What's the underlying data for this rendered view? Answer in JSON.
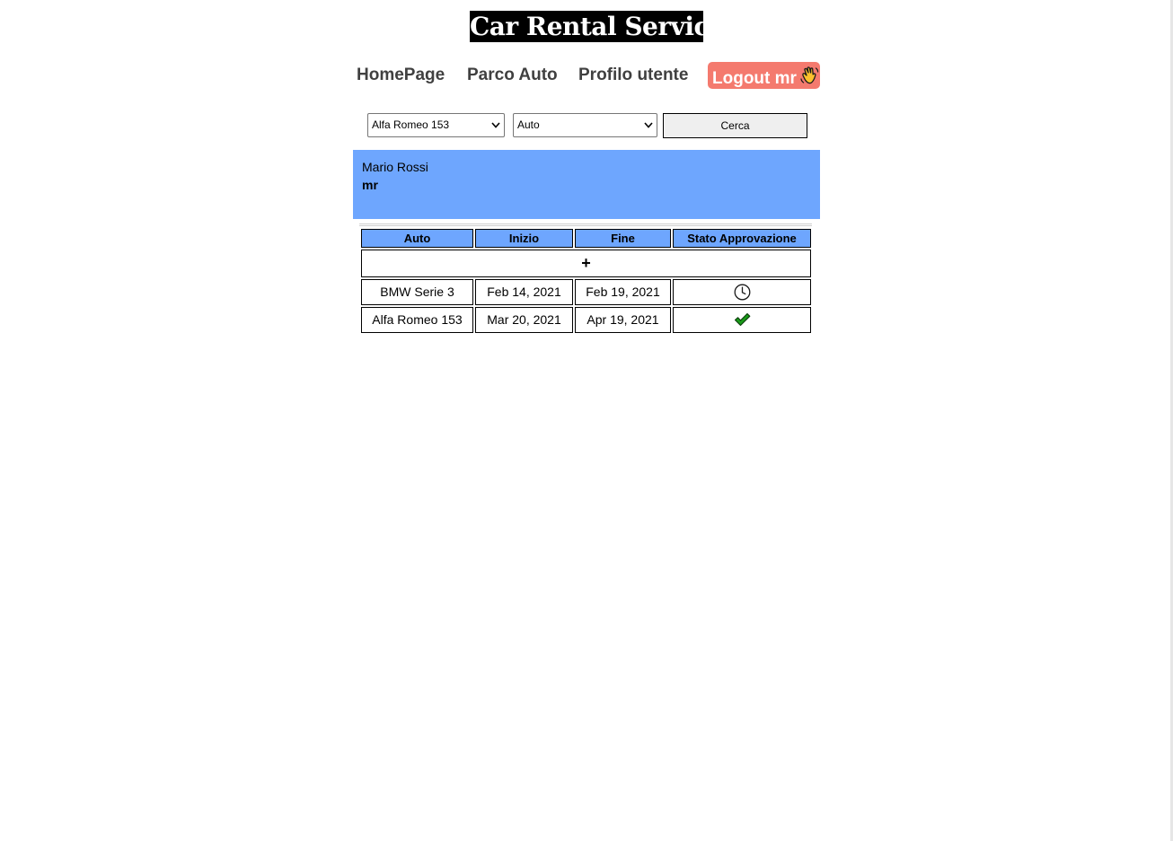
{
  "header": {
    "title": "Car Rental Service"
  },
  "nav": {
    "home": "HomePage",
    "fleet": "Parco Auto",
    "profile": "Profilo utente",
    "logout": "Logout mr"
  },
  "search": {
    "car_selected": "Alfa Romeo 153",
    "type_selected": "Auto",
    "button": "Cerca"
  },
  "profile": {
    "full_name": "Mario Rossi",
    "username": "mr"
  },
  "bookings": {
    "columns": [
      "Auto",
      "Inizio",
      "Fine",
      "Stato Approvazione"
    ],
    "add_label": "+",
    "rows": [
      {
        "car": "BMW Serie 3",
        "start": "Feb 14, 2021",
        "end": "Feb 19, 2021",
        "status": "pending"
      },
      {
        "car": "Alfa Romeo 153",
        "start": "Mar 20, 2021",
        "end": "Apr 19, 2021",
        "status": "approved"
      }
    ]
  },
  "colors": {
    "title_bg": "#000000",
    "accent_blue": "#6ea6fe",
    "logout_bg": "#f47a6e",
    "approved_green": "#1a9a1a"
  },
  "icons": {
    "logout": "waving-hand-icon",
    "pending": "clock-icon",
    "approved": "check-icon",
    "select": "chevron-down-icon"
  }
}
